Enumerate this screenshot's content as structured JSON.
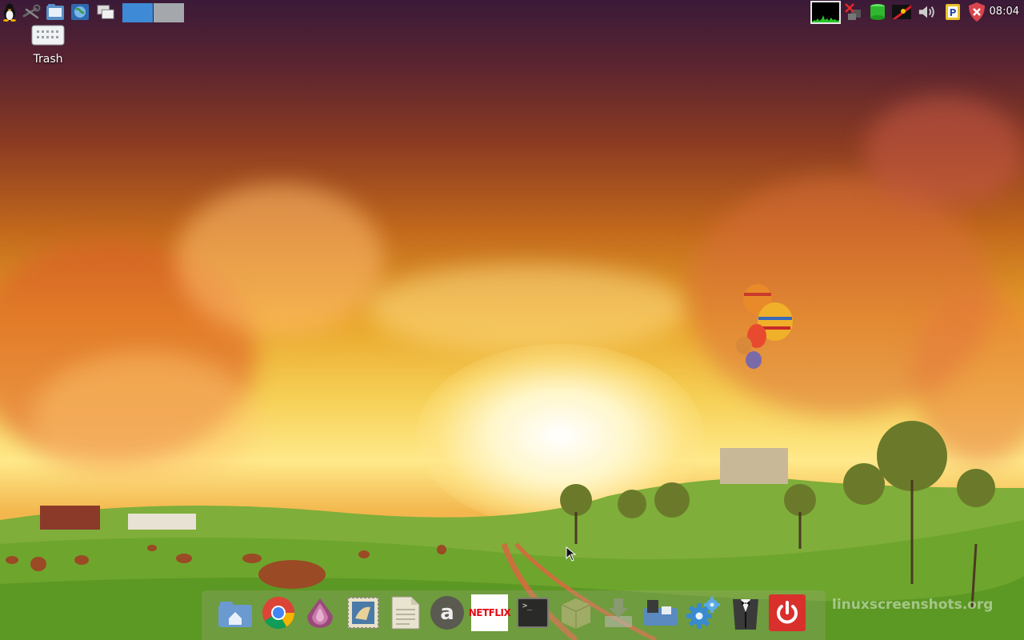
{
  "panel": {
    "workspaces": [
      {
        "label": "",
        "active": true
      },
      {
        "label": "",
        "active": false
      }
    ],
    "clock": "08:04"
  },
  "desktop": {
    "trash_label": "Trash"
  },
  "dock": {
    "netflix_label": "NETFLIX",
    "amazon_label": "a",
    "terminal_label": ">_",
    "watermark": "linuxscreenshots.org"
  },
  "colors": {
    "workspace_active": "#3e8ad6",
    "workspace_inactive": "#a4a8ad",
    "power_red": "#d9302c",
    "shield_red": "#d9454c"
  }
}
